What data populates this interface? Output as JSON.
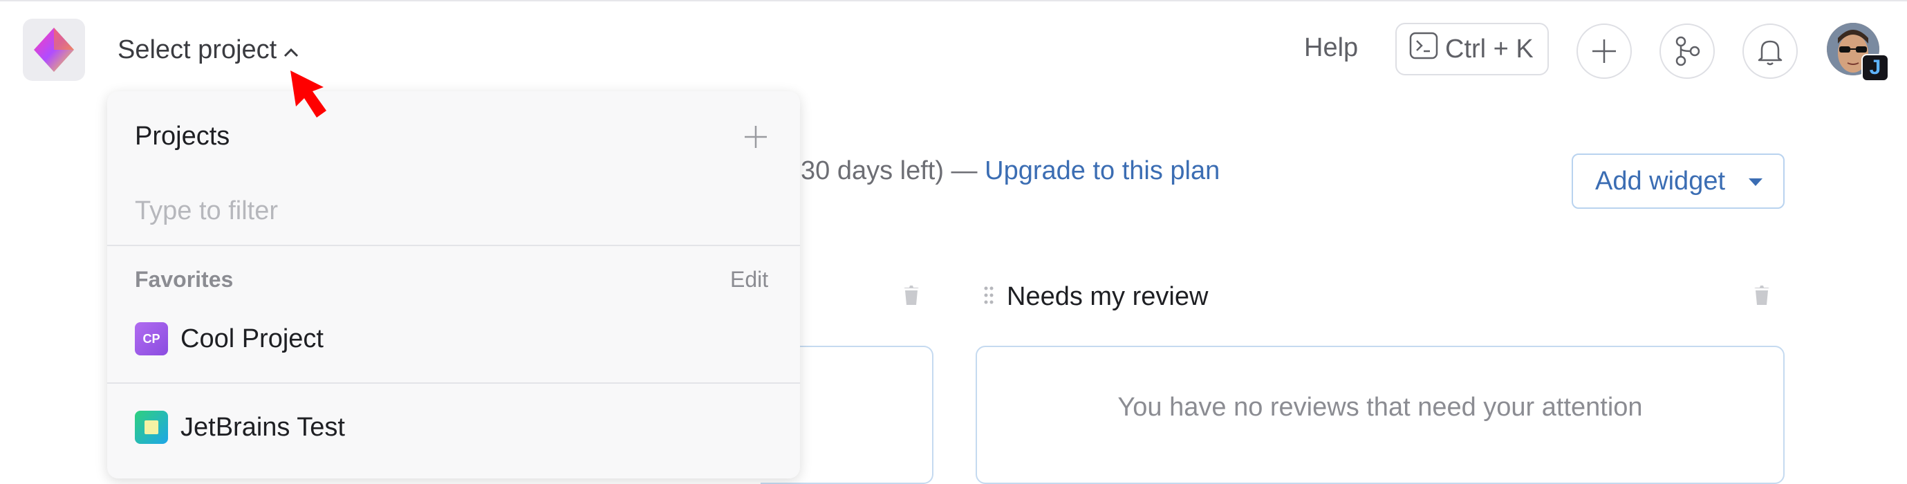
{
  "header": {
    "project_selector": "Select project",
    "help": "Help",
    "shortcut": "Ctrl + K",
    "avatar_badge": "J"
  },
  "main": {
    "trial_text": "30 days left) — ",
    "upgrade_link": "Upgrade to this plan",
    "add_widget": "Add widget",
    "review_widget_title": "Needs my review",
    "review_empty": "You have no reviews that need your attention"
  },
  "dropdown": {
    "title": "Projects",
    "filter_placeholder": "Type to filter",
    "favorites_label": "Favorites",
    "edit_label": "Edit",
    "favorites": [
      {
        "abbr": "CP",
        "name": "Cool Project"
      }
    ],
    "projects": [
      {
        "name": "JetBrains Test"
      }
    ]
  },
  "colors": {
    "accent": "#3b6db3",
    "pointer": "#ff0000"
  }
}
